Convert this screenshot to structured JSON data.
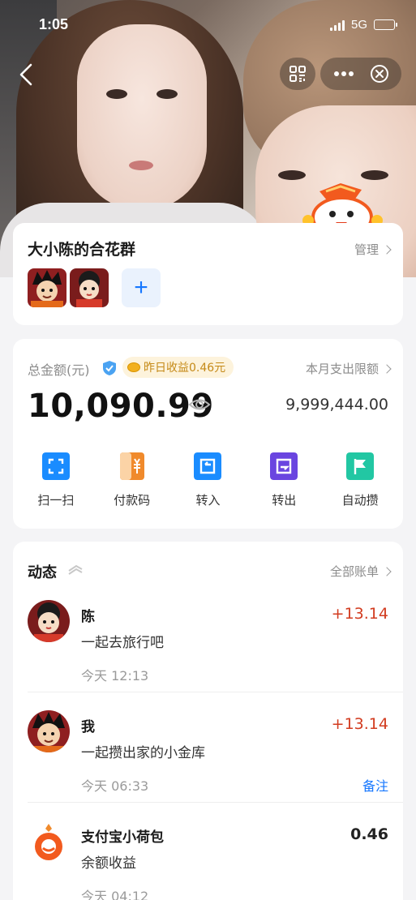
{
  "status_bar": {
    "time": "1:05",
    "network": "5G"
  },
  "group": {
    "title": "大小陈的合花群",
    "manage_label": "管理",
    "add_symbol": "+"
  },
  "balance": {
    "total_label": "总金额(元)",
    "yesterday_yield": "昨日收益0.46元",
    "monthly_limit_label": "本月支出限额",
    "amount": "10,090.99",
    "limit_value": "9,999,444.00"
  },
  "actions": [
    {
      "label": "扫一扫",
      "icon": "scan-icon",
      "color": "#1a8cff"
    },
    {
      "label": "付款码",
      "icon": "paycode-icon",
      "color": "#f08a2c"
    },
    {
      "label": "转入",
      "icon": "transfer-in-icon",
      "color": "#1a8cff"
    },
    {
      "label": "转出",
      "icon": "transfer-out-icon",
      "color": "#6a45e0"
    },
    {
      "label": "自动攒",
      "icon": "flag-icon",
      "color": "#22c7a3"
    }
  ],
  "feed": {
    "title": "动态",
    "all_bills_label": "全部账单",
    "items": [
      {
        "name": "陈",
        "message": "一起去旅行吧",
        "time": "今天 12:13",
        "amount": "+13.14"
      },
      {
        "name": "我",
        "message": "一起攒出家的小金库",
        "time": "今天 06:33",
        "amount": "+13.14",
        "note": "备注"
      },
      {
        "name": "支付宝小荷包",
        "message": "余额收益",
        "time": "今天 04:12",
        "amount": "0.46"
      }
    ]
  },
  "colors": {
    "accent": "#1677ff",
    "income": "#d23c20",
    "background": "#f4f4f6"
  }
}
